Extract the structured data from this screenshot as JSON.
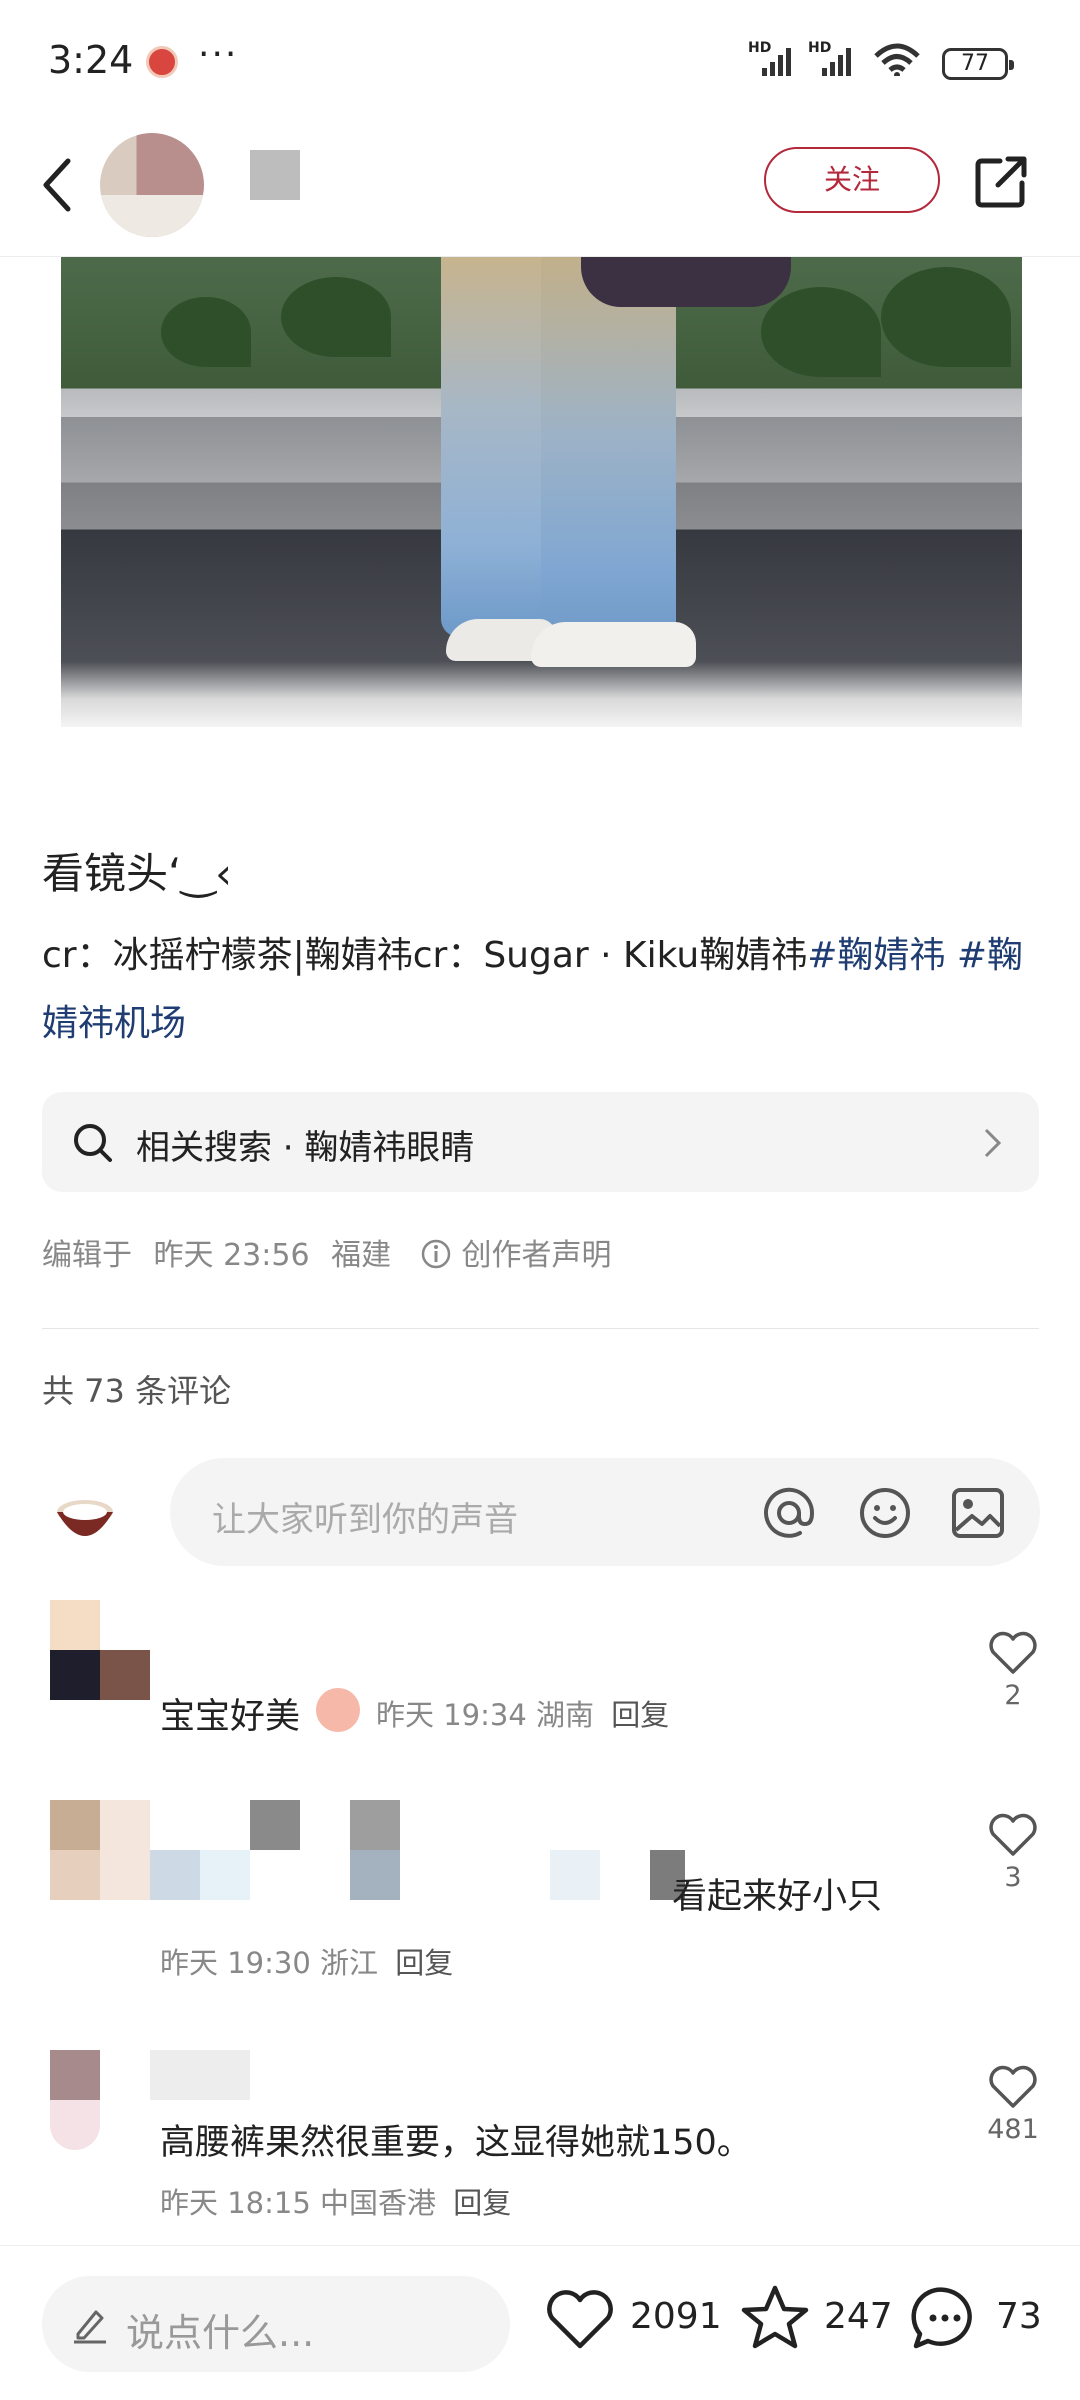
{
  "status_bar": {
    "time": "3:24",
    "more": "···",
    "signal_1": "HD",
    "signal_2": "HD",
    "battery": "77"
  },
  "header": {
    "follow_label": "关注",
    "icons": [
      "back-icon",
      "share-icon"
    ]
  },
  "post": {
    "title": "看镜头‘‿‹",
    "description_prefix": "cr：冰摇柠檬茶|鞠婧祎cr：Sugar · Kiku鞠婧祎",
    "tags": [
      "#鞠婧祎",
      "#鞠婧祎机场"
    ],
    "related_search": "相关搜索 · 鞠婧祎眼睛",
    "edited": "编辑于",
    "edited_time": "昨天 23:56",
    "edited_location": "福建",
    "creator_statement": "创作者声明"
  },
  "comments_section": {
    "count_label": "共 73 条评论",
    "input_placeholder": "让大家听到你的声音",
    "input_icons": [
      "at-icon",
      "emoji-icon",
      "image-icon"
    ],
    "comments": [
      {
        "text": "宝宝好美",
        "time": "昨天 19:34",
        "location": "湖南",
        "reply_label": "回复",
        "likes": "2"
      },
      {
        "text": "看起来好小只",
        "time": "昨天 19:30",
        "location": "浙江",
        "reply_label": "回复",
        "likes": "3"
      },
      {
        "text": "高腰裤果然很重要，这显得她就150。",
        "time": "昨天 18:15",
        "location": "中国香港",
        "reply_label": "回复",
        "likes": "481"
      }
    ]
  },
  "bottom_bar": {
    "say_placeholder": "说点什么...",
    "likes": "2091",
    "favorites": "247",
    "comments": "73"
  },
  "colors": {
    "accent": "#b3283b",
    "tag": "#1f3d72",
    "muted": "#888888"
  }
}
